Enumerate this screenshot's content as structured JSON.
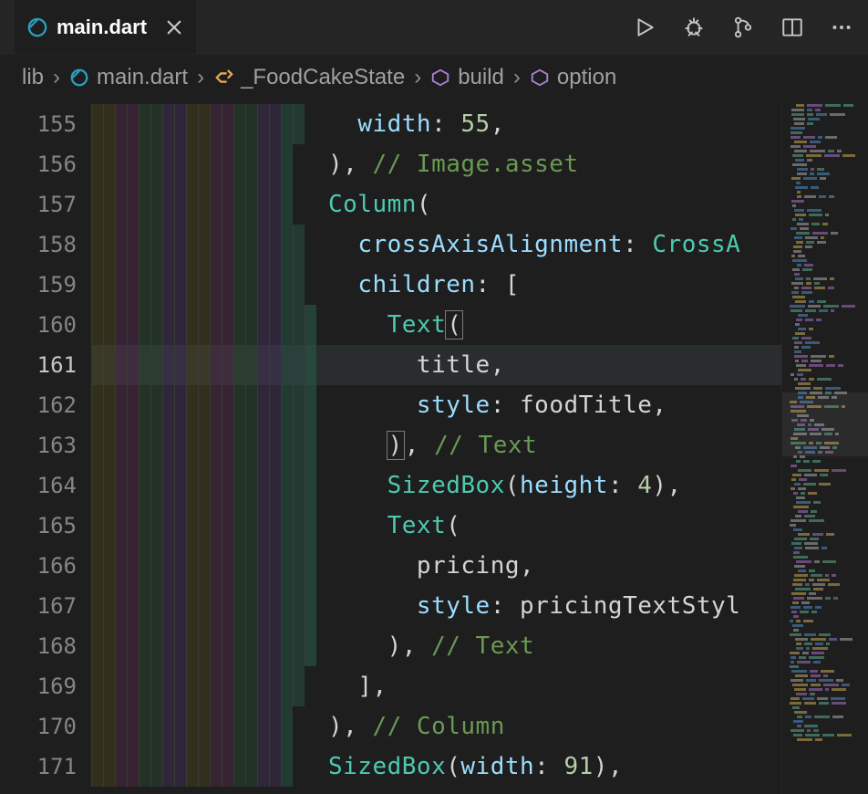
{
  "tab": {
    "label": "main.dart"
  },
  "breadcrumbs": {
    "items": [
      {
        "label": "lib",
        "icon": null
      },
      {
        "label": "main.dart",
        "icon": "dart"
      },
      {
        "label": "_FoodCakeState",
        "icon": "class"
      },
      {
        "label": "build",
        "icon": "method"
      },
      {
        "label": "option",
        "icon": "method"
      }
    ]
  },
  "lines": {
    "155": "        width: 55,",
    "156": "      ), // Image.asset",
    "157": "      Column(",
    "158": "        crossAxisAlignment: CrossA",
    "159": "        children: [",
    "160": "          Text(",
    "161": "            title,",
    "162": "            style: foodTitle,",
    "163": "          ), // Text",
    "164": "          SizedBox(height: 4),",
    "165": "          Text(",
    "166": "            pricing,",
    "167": "            style: pricingTextStyl",
    "168": "          ), // Text",
    "169": "        ],",
    "170": "      ), // Column",
    "171": "      SizedBox(width: 91),"
  },
  "tokens": {
    "155": [
      [
        "  ",
        "punc"
      ],
      [
        "width",
        "param"
      ],
      [
        ": ",
        "punc"
      ],
      [
        "55",
        "num"
      ],
      [
        ",",
        "punc"
      ]
    ],
    "156": [
      [
        "), ",
        "punc"
      ],
      [
        "// Image.asset",
        "comment"
      ]
    ],
    "157": [
      [
        "Column",
        "type"
      ],
      [
        "(",
        "punc"
      ]
    ],
    "158": [
      [
        "  ",
        "punc"
      ],
      [
        "crossAxisAlignment",
        "param"
      ],
      [
        ": ",
        "punc"
      ],
      [
        "CrossA",
        "cross"
      ]
    ],
    "159": [
      [
        "  ",
        "punc"
      ],
      [
        "children",
        "param"
      ],
      [
        ": [",
        "punc"
      ]
    ],
    "160": [
      [
        "    ",
        "punc"
      ],
      [
        "Text",
        "type"
      ],
      [
        "(",
        "bracket"
      ]
    ],
    "161": [
      [
        "      ",
        "punc"
      ],
      [
        "title",
        "id"
      ],
      [
        ",",
        "punc"
      ]
    ],
    "162": [
      [
        "      ",
        "punc"
      ],
      [
        "style",
        "param"
      ],
      [
        ": ",
        "punc"
      ],
      [
        "foodTitle",
        "id"
      ],
      [
        ",",
        "punc"
      ]
    ],
    "163": [
      [
        "    ",
        "punc"
      ],
      [
        ")",
        "bracket"
      ],
      [
        ", ",
        "punc"
      ],
      [
        "// Text",
        "comment"
      ]
    ],
    "164": [
      [
        "    ",
        "punc"
      ],
      [
        "SizedBox",
        "type"
      ],
      [
        "(",
        "punc"
      ],
      [
        "height",
        "param"
      ],
      [
        ": ",
        "punc"
      ],
      [
        "4",
        "num"
      ],
      [
        "),",
        "punc"
      ]
    ],
    "165": [
      [
        "    ",
        "punc"
      ],
      [
        "Text",
        "type"
      ],
      [
        "(",
        "punc"
      ]
    ],
    "166": [
      [
        "      ",
        "punc"
      ],
      [
        "pricing",
        "id"
      ],
      [
        ",",
        "punc"
      ]
    ],
    "167": [
      [
        "      ",
        "punc"
      ],
      [
        "style",
        "param"
      ],
      [
        ": ",
        "punc"
      ],
      [
        "pricingTextStyl",
        "id"
      ]
    ],
    "168": [
      [
        "    ",
        "punc"
      ],
      [
        "), ",
        "punc"
      ],
      [
        "// Text",
        "comment"
      ]
    ],
    "169": [
      [
        "  ",
        "punc"
      ],
      [
        "],",
        "punc"
      ]
    ],
    "170": [
      [
        "), ",
        "punc"
      ],
      [
        "// Column",
        "comment"
      ]
    ],
    "171": [
      [
        "SizedBox",
        "type"
      ],
      [
        "(",
        "punc"
      ],
      [
        "width",
        "param"
      ],
      [
        ": ",
        "punc"
      ],
      [
        "91",
        "num"
      ],
      [
        "),",
        "punc"
      ]
    ]
  },
  "line_numbers": [
    "155",
    "156",
    "157",
    "158",
    "159",
    "160",
    "161",
    "162",
    "163",
    "164",
    "165",
    "166",
    "167",
    "168",
    "169",
    "170",
    "171"
  ],
  "active_line": "161",
  "indent_levels": {
    "155": 18,
    "156": 17,
    "157": 17,
    "158": 18,
    "159": 18,
    "160": 19,
    "161": 19,
    "162": 19,
    "163": 19,
    "164": 19,
    "165": 19,
    "166": 19,
    "167": 19,
    "168": 19,
    "169": 18,
    "170": 17,
    "171": 17
  }
}
